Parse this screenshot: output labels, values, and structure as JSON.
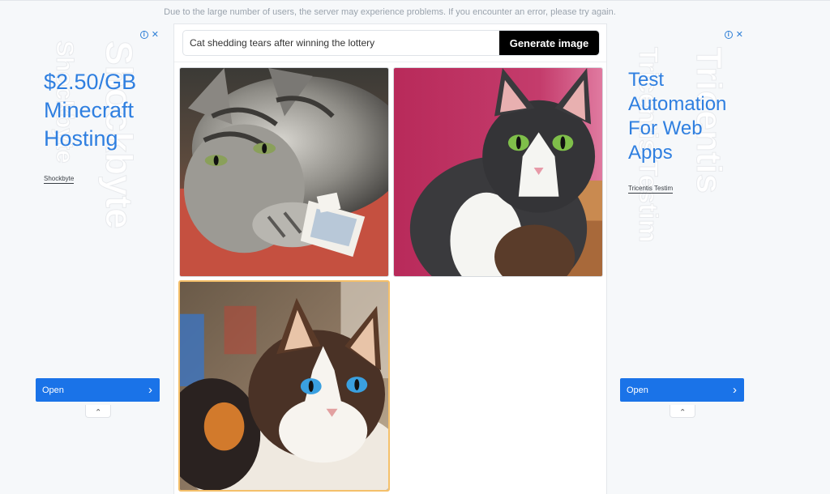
{
  "notice": "Due to the large number of users, the server may experience problems. If you encounter an error, please try again.",
  "prompt": {
    "value": "Cat shedding tears after winning the lottery",
    "button_label": "Generate image"
  },
  "results": [
    {
      "alt": "grey tabby cat lying on red carpet next to banknote"
    },
    {
      "alt": "black and white cat sitting against pink background"
    },
    {
      "alt": "long-haired calico cat with blue eyes"
    }
  ],
  "ads": {
    "left": {
      "headline": "$2.50/GB Minecraft Hosting",
      "brand": "Shockbyte",
      "watermark": "Shockbyte",
      "open_label": "Open"
    },
    "right": {
      "headline": "Test Automation For Web Apps",
      "brand": "Tricentis Testim",
      "watermark": "Tricentis",
      "watermark2": "Tricentis Testim",
      "open_label": "Open"
    }
  },
  "colors": {
    "accent": "#2f7fe0",
    "button": "#000000",
    "ad_button": "#1a73e8",
    "selected_border": "#f5c06a"
  }
}
